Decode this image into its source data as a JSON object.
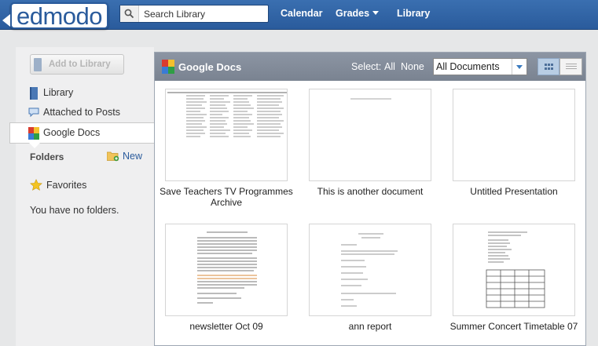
{
  "brand": {
    "logo_text": "edmodo"
  },
  "search": {
    "placeholder": "Search Library",
    "value": "Search Library"
  },
  "nav": {
    "calendar": "Calendar",
    "grades": "Grades",
    "library": "Library"
  },
  "sidebar": {
    "add_button": "Add to Library",
    "items": [
      {
        "label": "Library",
        "icon": "book-icon"
      },
      {
        "label": "Attached to Posts",
        "icon": "speech-bubble-icon"
      },
      {
        "label": "Google Docs",
        "icon": "google-docs-icon",
        "active": true
      }
    ],
    "folders_header": "Folders",
    "new_folder": "New",
    "favorites": "Favorites",
    "empty_message": "You have no folders."
  },
  "panel": {
    "title": "Google Docs",
    "select_label": "Select:",
    "select_all": "All",
    "select_none": "None",
    "filter_value": "All Documents",
    "view_modes": [
      "grid-view-icon",
      "list-view-icon"
    ],
    "documents": [
      {
        "title": "Save Teachers TV Programmes Archive",
        "kind": "spreadsheet"
      },
      {
        "title": "This is another document",
        "kind": "blank-doc"
      },
      {
        "title": "Untitled Presentation",
        "kind": "blank"
      },
      {
        "title": "newsletter Oct 09",
        "kind": "text-dense"
      },
      {
        "title": "ann report",
        "kind": "text-sparse"
      },
      {
        "title": "Summer Concert Timetable 07",
        "kind": "table"
      }
    ]
  },
  "colors": {
    "topbar": "#2a5b9c",
    "panel_header": "#848d9b",
    "link": "#2a5b9c"
  }
}
